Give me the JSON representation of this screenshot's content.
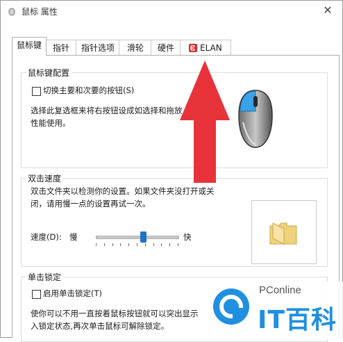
{
  "window": {
    "title": "鼠标 属性",
    "close_glyph": "✕"
  },
  "tabs": [
    "鼠标键",
    "指针",
    "指针选项",
    "滑轮",
    "硬件",
    "ELAN"
  ],
  "button_config": {
    "group_label": "鼠标键配置",
    "switch_checkbox_label": "切换主要和次要的按钮(S)",
    "switch_checked": false,
    "description_line1": "选择此复选框来将右按钮设成如选择和拖放",
    "description_line2": "性能使用。"
  },
  "double_click": {
    "group_label": "双击速度",
    "description_line1": "双击文件夹以检测你的设置。如果文件夹没打开或关",
    "description_line2": "闭，请用慢一点的设置再试一次。",
    "speed_label": "速度(D):",
    "slow_label": "慢",
    "fast_label": "快",
    "speed_value_fraction": 0.58
  },
  "click_lock": {
    "group_label": "单击锁定",
    "checkbox_label": "启用单击锁定(T)",
    "checked": false,
    "description_line1": "使你可以不用一直按着鼠标按钮就可以突出显示",
    "description_line2": "入锁定状态,再次单击鼠标可解除锁定。"
  },
  "watermark": {
    "brand": "PConline",
    "logo_text": "IT百科"
  },
  "colors": {
    "arrow": "#e8323a",
    "accent": "#1e72c8",
    "mouse_blue": "#3aa2e8"
  }
}
